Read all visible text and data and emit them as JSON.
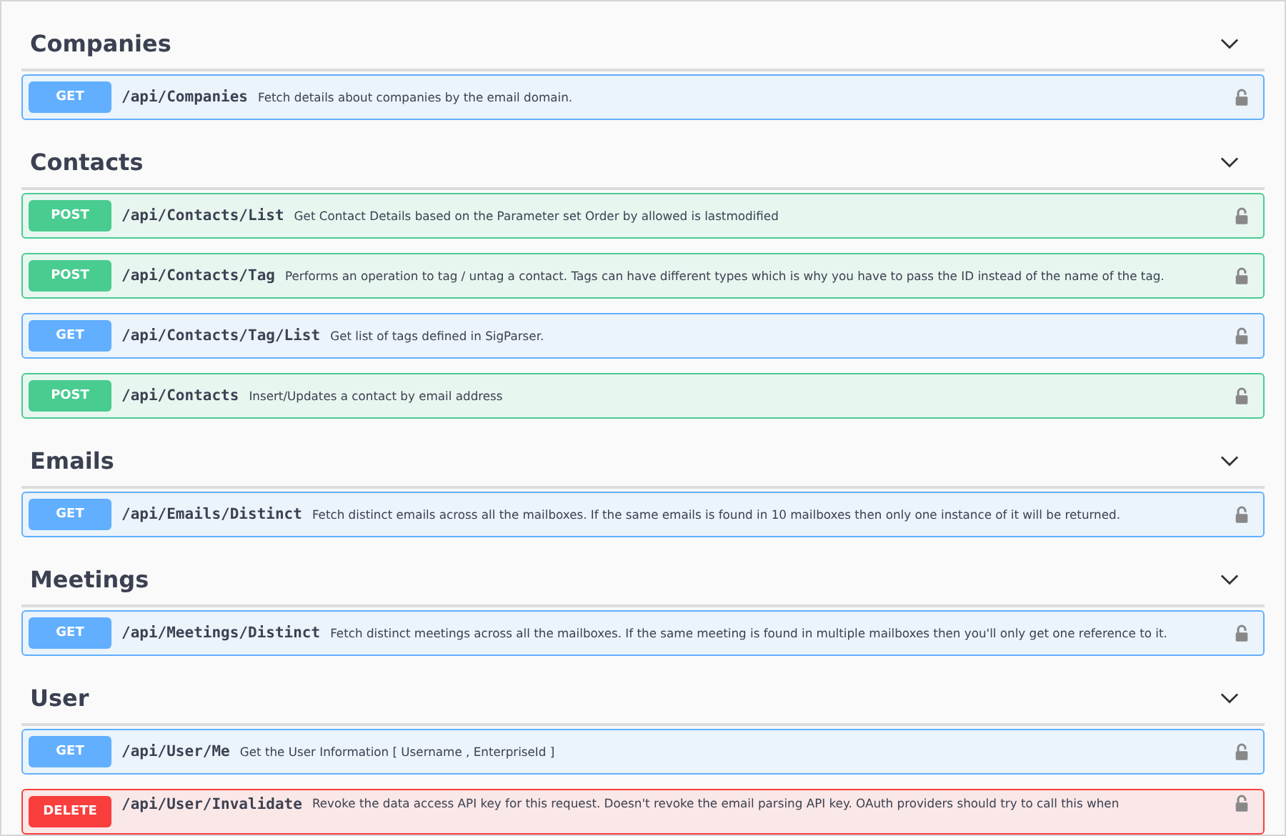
{
  "sections": [
    {
      "title": "Companies",
      "expanded": true,
      "operations": [
        {
          "method": "GET",
          "path": "/api/Companies",
          "description": "Fetch details about companies by the email domain."
        }
      ]
    },
    {
      "title": "Contacts",
      "expanded": true,
      "operations": [
        {
          "method": "POST",
          "path": "/api/Contacts/List",
          "description": "Get Contact Details based on the Parameter set Order by allowed is lastmodified"
        },
        {
          "method": "POST",
          "path": "/api/Contacts/Tag",
          "description": "Performs an operation to tag / untag a contact. Tags can have different types which is why you have to pass the ID instead of the name of the tag."
        },
        {
          "method": "GET",
          "path": "/api/Contacts/Tag/List",
          "description": "Get list of tags defined in SigParser."
        },
        {
          "method": "POST",
          "path": "/api/Contacts",
          "description": "Insert/Updates a contact by email address"
        }
      ]
    },
    {
      "title": "Emails",
      "expanded": true,
      "operations": [
        {
          "method": "GET",
          "path": "/api/Emails/Distinct",
          "description": "Fetch distinct emails across all the mailboxes. If the same emails is found in 10 mailboxes then only one instance of it will be returned."
        }
      ]
    },
    {
      "title": "Meetings",
      "expanded": true,
      "operations": [
        {
          "method": "GET",
          "path": "/api/Meetings/Distinct",
          "description": "Fetch distinct meetings across all the mailboxes. If the same meeting is found in multiple mailboxes then you'll only get one reference to it."
        }
      ]
    },
    {
      "title": "User",
      "expanded": true,
      "operations": [
        {
          "method": "GET",
          "path": "/api/User/Me",
          "description": "Get the User Information [ Username , EnterpriseId ]"
        },
        {
          "method": "DELETE",
          "path": "/api/User/Invalidate",
          "description": "Revoke the data access API key for this request. Doesn't revoke the email parsing API key. OAuth providers should try to call this when"
        }
      ]
    }
  ]
}
